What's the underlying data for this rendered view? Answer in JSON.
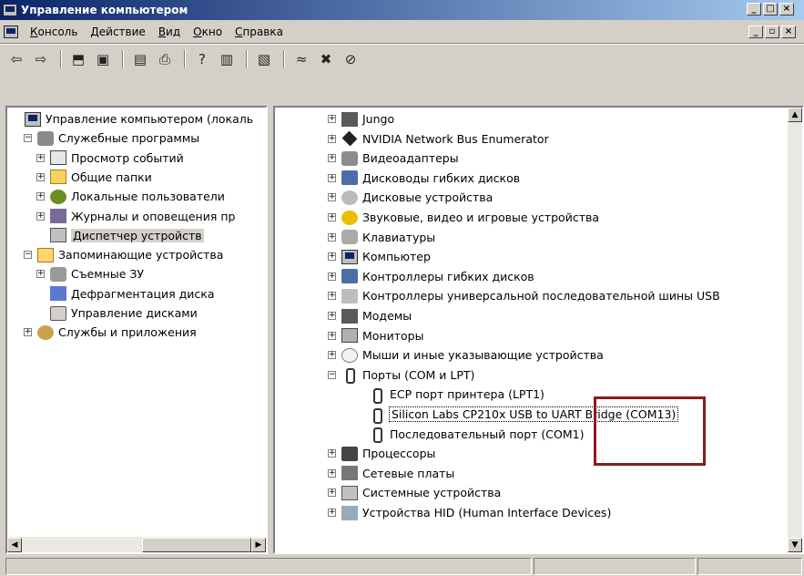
{
  "window": {
    "title": "Управление компьютером"
  },
  "menu": {
    "items": [
      "Консоль",
      "Действие",
      "Вид",
      "Окно",
      "Справка"
    ]
  },
  "left_tree": [
    {
      "label": "Управление компьютером (локаль",
      "icon": "computer-icon",
      "level": 0,
      "expander": ""
    },
    {
      "label": "Служебные программы",
      "icon": "tools-icon",
      "level": 1,
      "expander": "−"
    },
    {
      "label": "Просмотр событий",
      "icon": "event-log-icon",
      "level": 2,
      "expander": "+"
    },
    {
      "label": "Общие папки",
      "icon": "shared-folder-icon",
      "level": 2,
      "expander": "+"
    },
    {
      "label": "Локальные пользователи",
      "icon": "users-icon",
      "level": 2,
      "expander": "+"
    },
    {
      "label": "Журналы и оповещения пр",
      "icon": "performance-icon",
      "level": 2,
      "expander": "+"
    },
    {
      "label": "Диспетчер устройств",
      "icon": "device-manager-icon",
      "level": 2,
      "expander": "",
      "selected": true
    },
    {
      "label": "Запоминающие устройства",
      "icon": "storage-icon",
      "level": 1,
      "expander": "−"
    },
    {
      "label": "Съемные ЗУ",
      "icon": "removable-storage-icon",
      "level": 2,
      "expander": "+"
    },
    {
      "label": "Дефрагментация диска",
      "icon": "defrag-icon",
      "level": 2,
      "expander": ""
    },
    {
      "label": "Управление дисками",
      "icon": "disk-management-icon",
      "level": 2,
      "expander": ""
    },
    {
      "label": "Службы и приложения",
      "icon": "services-icon",
      "level": 1,
      "expander": "+"
    }
  ],
  "right_tree": [
    {
      "label": "Jungo",
      "icon": "card-icon",
      "level": 1,
      "expander": "+"
    },
    {
      "label": "NVIDIA Network Bus Enumerator",
      "icon": "chip-icon",
      "level": 1,
      "expander": "+"
    },
    {
      "label": "Видеоадаптеры",
      "icon": "video-adapter-icon",
      "level": 1,
      "expander": "+"
    },
    {
      "label": "Дисководы гибких дисков",
      "icon": "floppy-drive-icon",
      "level": 1,
      "expander": "+"
    },
    {
      "label": "Дисковые устройства",
      "icon": "disk-drive-icon",
      "level": 1,
      "expander": "+"
    },
    {
      "label": "Звуковые, видео и игровые устройства",
      "icon": "sound-icon",
      "level": 1,
      "expander": "+"
    },
    {
      "label": "Клавиатуры",
      "icon": "keyboard-icon",
      "level": 1,
      "expander": "+"
    },
    {
      "label": "Компьютер",
      "icon": "computer-icon",
      "level": 1,
      "expander": "+"
    },
    {
      "label": "Контроллеры гибких дисков",
      "icon": "floppy-controller-icon",
      "level": 1,
      "expander": "+"
    },
    {
      "label": "Контроллеры универсальной последовательной шины USB",
      "icon": "usb-icon",
      "level": 1,
      "expander": "+"
    },
    {
      "label": "Модемы",
      "icon": "modem-icon",
      "level": 1,
      "expander": "+"
    },
    {
      "label": "Мониторы",
      "icon": "monitor-icon",
      "level": 1,
      "expander": "+"
    },
    {
      "label": "Мыши и иные указывающие устройства",
      "icon": "mouse-icon",
      "level": 1,
      "expander": "+"
    },
    {
      "label": "Порты (COM и LPT)",
      "icon": "port-icon",
      "level": 1,
      "expander": "−"
    },
    {
      "label": "ECP порт принтера (LPT1)",
      "icon": "port-icon",
      "level": 2,
      "expander": ""
    },
    {
      "label": "Silicon Labs CP210x USB to UART Bridge (COM13)",
      "icon": "port-icon",
      "level": 2,
      "expander": "",
      "selected": true
    },
    {
      "label": "Последовательный порт (COM1)",
      "icon": "port-icon",
      "level": 2,
      "expander": ""
    },
    {
      "label": "Процессоры",
      "icon": "cpu-icon",
      "level": 1,
      "expander": "+"
    },
    {
      "label": "Сетевые платы",
      "icon": "network-card-icon",
      "level": 1,
      "expander": "+"
    },
    {
      "label": "Системные устройства",
      "icon": "system-devices-icon",
      "level": 1,
      "expander": "+"
    },
    {
      "label": "Устройства HID (Human Interface Devices)",
      "icon": "hid-icon",
      "level": 1,
      "expander": "+"
    }
  ],
  "colors": {
    "titlebar_start": "#0a246a",
    "titlebar_end": "#a6caf0",
    "chrome": "#d4d0c8",
    "highlight_box": "#8b1a1a"
  }
}
